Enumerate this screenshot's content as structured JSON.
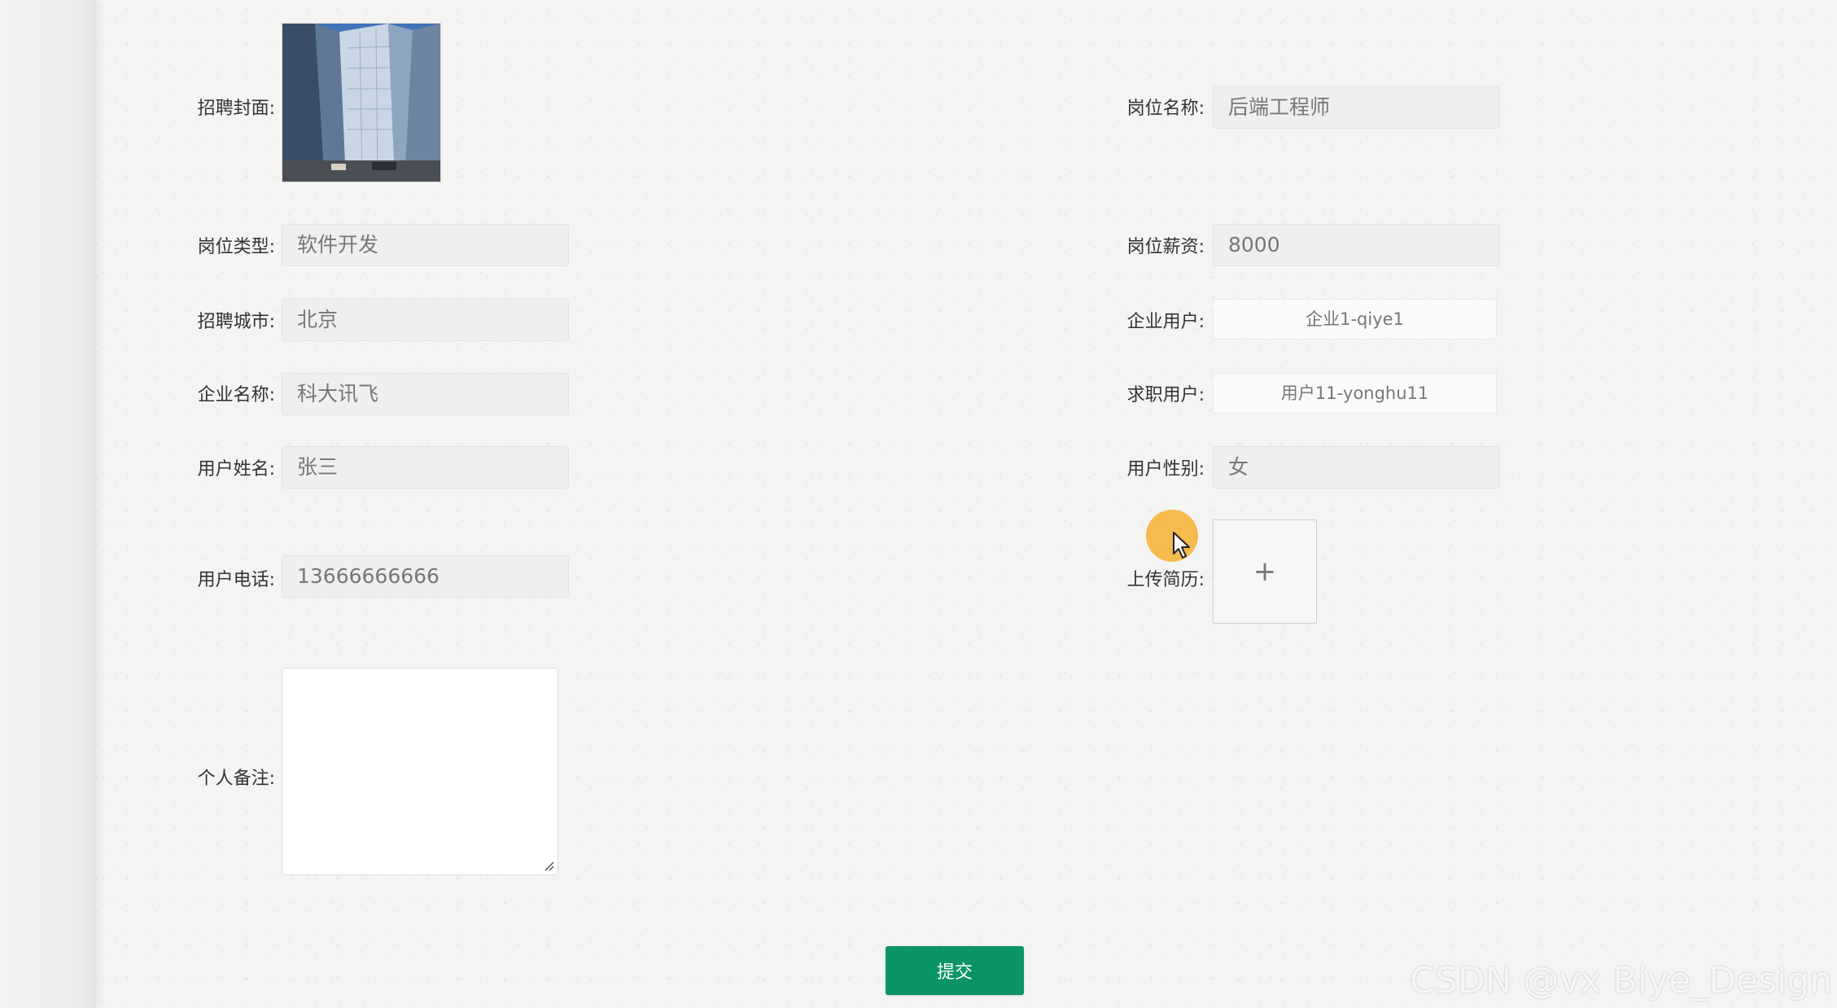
{
  "form": {
    "cover_label": "招聘封面:",
    "job_name_label": "岗位名称:",
    "job_name_value": "后端工程师",
    "job_type_label": "岗位类型:",
    "job_type_value": "软件开发",
    "salary_label": "岗位薪资:",
    "salary_value": "8000",
    "city_label": "招聘城市:",
    "city_value": "北京",
    "company_user_label": "企业用户:",
    "company_user_value": "企业1-qiye1",
    "company_name_label": "企业名称:",
    "company_name_value": "科大讯飞",
    "job_user_label": "求职用户:",
    "job_user_value": "用户11-yonghu11",
    "user_name_label": "用户姓名:",
    "user_name_value": "张三",
    "gender_label": "用户性别:",
    "gender_value": "女",
    "phone_label": "用户电话:",
    "phone_value": "13666666666",
    "resume_label": "上传简历:",
    "upload_plus": "+",
    "note_label": "个人备注:",
    "note_value": "",
    "submit_label": "提交"
  },
  "watermark": "CSDN @vx Biye_Design",
  "colors": {
    "submit": "#0b9466",
    "cursor_halo": "#f5af28"
  }
}
